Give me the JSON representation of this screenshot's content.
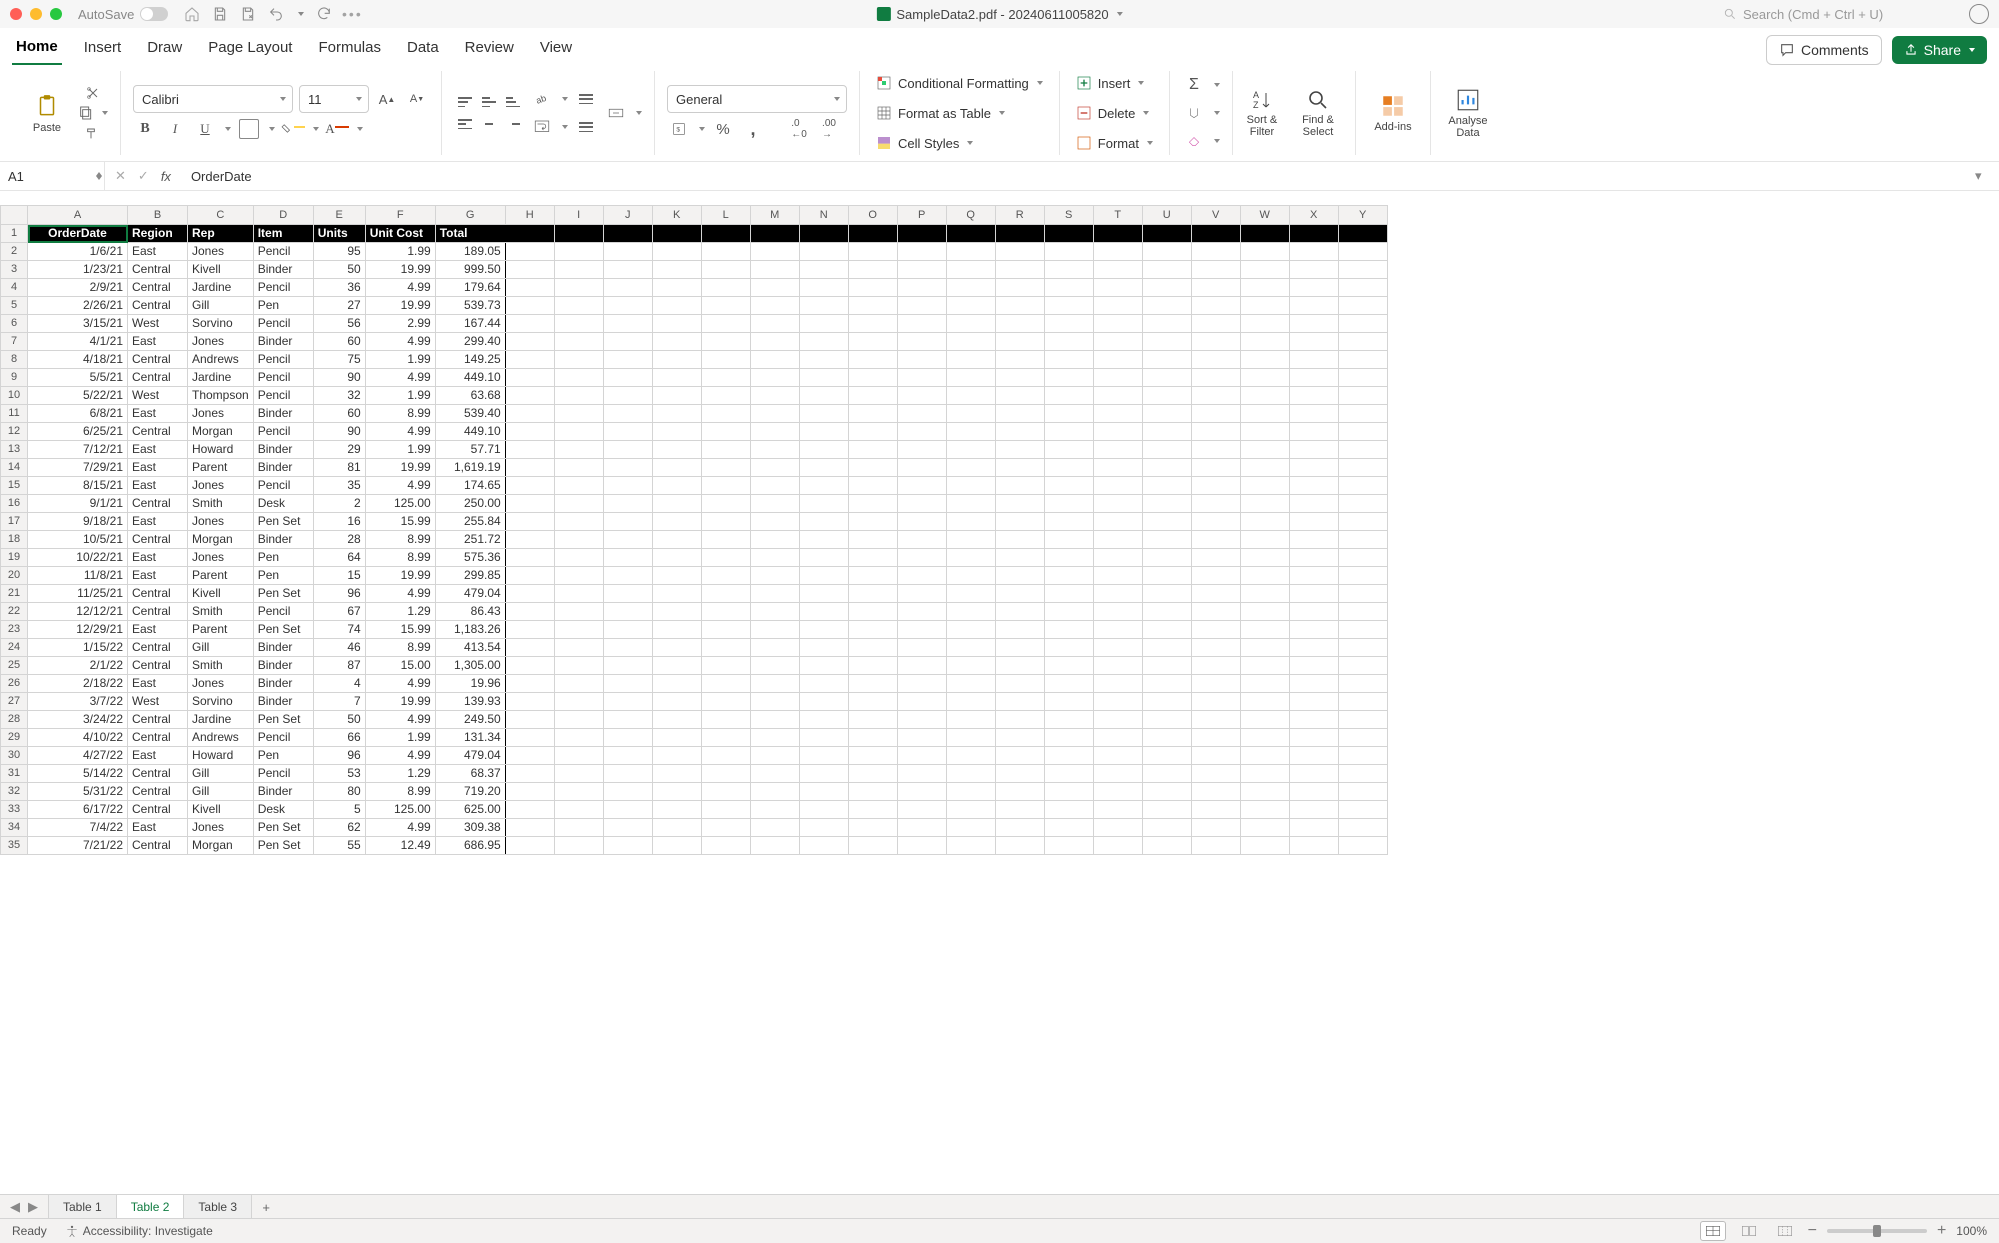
{
  "titlebar": {
    "autosave_label": "AutoSave",
    "doc_title": "SampleData2.pdf - 20240611005820"
  },
  "search": {
    "placeholder": "Search (Cmd + Ctrl + U)"
  },
  "tabs": {
    "items": [
      "Home",
      "Insert",
      "Draw",
      "Page Layout",
      "Formulas",
      "Data",
      "Review",
      "View"
    ],
    "active": 0,
    "comments_label": "Comments",
    "share_label": "Share"
  },
  "ribbon": {
    "paste_label": "Paste",
    "font_name": "Calibri",
    "font_size": "11",
    "number_format": "General",
    "cond_fmt": "Conditional Formatting",
    "fmt_table": "Format as Table",
    "cell_styles": "Cell Styles",
    "insert": "Insert",
    "delete": "Delete",
    "format": "Format",
    "sort_filter": "Sort &\nFilter",
    "find_select": "Find &\nSelect",
    "addins": "Add-ins",
    "analyse": "Analyse\nData"
  },
  "fx": {
    "name_box": "A1",
    "formula": "OrderDate"
  },
  "sheet": {
    "col_letters": [
      "A",
      "B",
      "C",
      "D",
      "E",
      "F",
      "G",
      "H",
      "I",
      "J",
      "K",
      "L",
      "M",
      "N",
      "O",
      "P",
      "Q",
      "R",
      "S",
      "T",
      "U",
      "V",
      "W",
      "X",
      "Y"
    ],
    "rest_cols": 18,
    "headers": [
      "OrderDate",
      "Region",
      "Rep",
      "Item",
      "Units",
      "Unit Cost",
      "Total"
    ],
    "header_align": [
      "center",
      "left",
      "left",
      "left",
      "left",
      "left",
      "left"
    ],
    "rows": [
      [
        "1/6/21",
        "East",
        "Jones",
        "Pencil",
        "95",
        "1.99",
        "189.05"
      ],
      [
        "1/23/21",
        "Central",
        "Kivell",
        "Binder",
        "50",
        "19.99",
        "999.50"
      ],
      [
        "2/9/21",
        "Central",
        "Jardine",
        "Pencil",
        "36",
        "4.99",
        "179.64"
      ],
      [
        "2/26/21",
        "Central",
        "Gill",
        "Pen",
        "27",
        "19.99",
        "539.73"
      ],
      [
        "3/15/21",
        "West",
        "Sorvino",
        "Pencil",
        "56",
        "2.99",
        "167.44"
      ],
      [
        "4/1/21",
        "East",
        "Jones",
        "Binder",
        "60",
        "4.99",
        "299.40"
      ],
      [
        "4/18/21",
        "Central",
        "Andrews",
        "Pencil",
        "75",
        "1.99",
        "149.25"
      ],
      [
        "5/5/21",
        "Central",
        "Jardine",
        "Pencil",
        "90",
        "4.99",
        "449.10"
      ],
      [
        "5/22/21",
        "West",
        "Thompson",
        "Pencil",
        "32",
        "1.99",
        "63.68"
      ],
      [
        "6/8/21",
        "East",
        "Jones",
        "Binder",
        "60",
        "8.99",
        "539.40"
      ],
      [
        "6/25/21",
        "Central",
        "Morgan",
        "Pencil",
        "90",
        "4.99",
        "449.10"
      ],
      [
        "7/12/21",
        "East",
        "Howard",
        "Binder",
        "29",
        "1.99",
        "57.71"
      ],
      [
        "7/29/21",
        "East",
        "Parent",
        "Binder",
        "81",
        "19.99",
        "1,619.19"
      ],
      [
        "8/15/21",
        "East",
        "Jones",
        "Pencil",
        "35",
        "4.99",
        "174.65"
      ],
      [
        "9/1/21",
        "Central",
        "Smith",
        "Desk",
        "2",
        "125.00",
        "250.00"
      ],
      [
        "9/18/21",
        "East",
        "Jones",
        "Pen Set",
        "16",
        "15.99",
        "255.84"
      ],
      [
        "10/5/21",
        "Central",
        "Morgan",
        "Binder",
        "28",
        "8.99",
        "251.72"
      ],
      [
        "10/22/21",
        "East",
        "Jones",
        "Pen",
        "64",
        "8.99",
        "575.36"
      ],
      [
        "11/8/21",
        "East",
        "Parent",
        "Pen",
        "15",
        "19.99",
        "299.85"
      ],
      [
        "11/25/21",
        "Central",
        "Kivell",
        "Pen Set",
        "96",
        "4.99",
        "479.04"
      ],
      [
        "12/12/21",
        "Central",
        "Smith",
        "Pencil",
        "67",
        "1.29",
        "86.43"
      ],
      [
        "12/29/21",
        "East",
        "Parent",
        "Pen Set",
        "74",
        "15.99",
        "1,183.26"
      ],
      [
        "1/15/22",
        "Central",
        "Gill",
        "Binder",
        "46",
        "8.99",
        "413.54"
      ],
      [
        "2/1/22",
        "Central",
        "Smith",
        "Binder",
        "87",
        "15.00",
        "1,305.00"
      ],
      [
        "2/18/22",
        "East",
        "Jones",
        "Binder",
        "4",
        "4.99",
        "19.96"
      ],
      [
        "3/7/22",
        "West",
        "Sorvino",
        "Binder",
        "7",
        "19.99",
        "139.93"
      ],
      [
        "3/24/22",
        "Central",
        "Jardine",
        "Pen Set",
        "50",
        "4.99",
        "249.50"
      ],
      [
        "4/10/22",
        "Central",
        "Andrews",
        "Pencil",
        "66",
        "1.99",
        "131.34"
      ],
      [
        "4/27/22",
        "East",
        "Howard",
        "Pen",
        "96",
        "4.99",
        "479.04"
      ],
      [
        "5/14/22",
        "Central",
        "Gill",
        "Pencil",
        "53",
        "1.29",
        "68.37"
      ],
      [
        "5/31/22",
        "Central",
        "Gill",
        "Binder",
        "80",
        "8.99",
        "719.20"
      ],
      [
        "6/17/22",
        "Central",
        "Kivell",
        "Desk",
        "5",
        "125.00",
        "625.00"
      ],
      [
        "7/4/22",
        "East",
        "Jones",
        "Pen Set",
        "62",
        "4.99",
        "309.38"
      ],
      [
        "7/21/22",
        "Central",
        "Morgan",
        "Pen Set",
        "55",
        "12.49",
        "686.95"
      ]
    ],
    "col_types": [
      "num",
      "txt",
      "txt",
      "txt",
      "num",
      "num",
      "num"
    ]
  },
  "sheets": {
    "tabs": [
      "Table 1",
      "Table 2",
      "Table 3"
    ],
    "active": 1
  },
  "status": {
    "ready": "Ready",
    "accessibility": "Accessibility: Investigate",
    "zoom": "100%"
  }
}
